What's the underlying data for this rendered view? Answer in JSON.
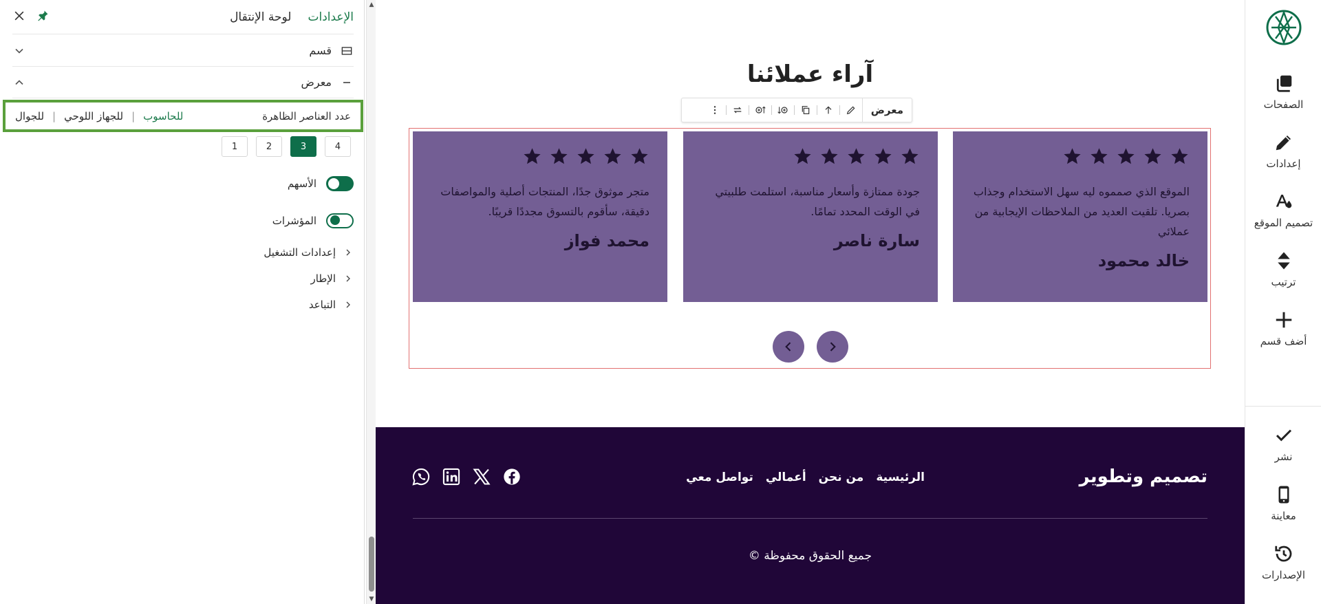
{
  "panel": {
    "tabs": {
      "settings": "الإعدادات",
      "navigator": "لوحة الإنتقال"
    },
    "section_row": "قسم",
    "gallery_row": "معرض",
    "device": {
      "title": "عدد العناصر الظاهرة",
      "desktop": "للحاسوب",
      "tablet": "للجهاز اللوحي",
      "mobile": "للجوال"
    },
    "counts": [
      "1",
      "2",
      "3",
      "4"
    ],
    "selected_count": "3",
    "arrows_label": "الأسهم",
    "arrows_on": true,
    "indicators_label": "المؤشرات",
    "indicators_on": false,
    "autoplay_label": "إعدادات التشغيل",
    "border_label": "الإطار",
    "spacing_label": "التباعد"
  },
  "canvas": {
    "title": "آراء عملائنا",
    "toolbar_label": "معرض",
    "testimonials": [
      {
        "stars": 5,
        "text": "الموقع الذي صمموه ليه سهل الاستخدام وجذاب بصريا. تلقيت العديد من الملاحظات الإيجابية من عملائي",
        "author": "خالد محمود"
      },
      {
        "stars": 5,
        "text": "جودة ممتازة وأسعار مناسبة، استلمت طلبيتي في الوقت المحدد تمامًا.",
        "author": "سارة ناصر"
      },
      {
        "stars": 5,
        "text": "متجر موثوق جدًا، المنتجات أصلية والمواصفات دقيقة، سأقوم بالتسوق مجددًا قريبًا.",
        "author": "محمد فواز"
      }
    ],
    "card_color": "#735e94",
    "footer": {
      "brand": "تصميم وتطوير",
      "links": [
        "الرئيسية",
        "من نحن",
        "أعمالي",
        "تواصل معي"
      ],
      "copyright": "جميع الحقوق محفوظة ©",
      "background": "#200638"
    }
  },
  "rail": {
    "pages": "الصفحات",
    "settings": "إعدادات",
    "design": "تصميم الموقع",
    "order": "ترتيب",
    "add_section": "أضف قسم",
    "publish": "نشر",
    "preview": "معاينة",
    "versions": "الإصدارات"
  },
  "accent_color": "#0e6e4a"
}
